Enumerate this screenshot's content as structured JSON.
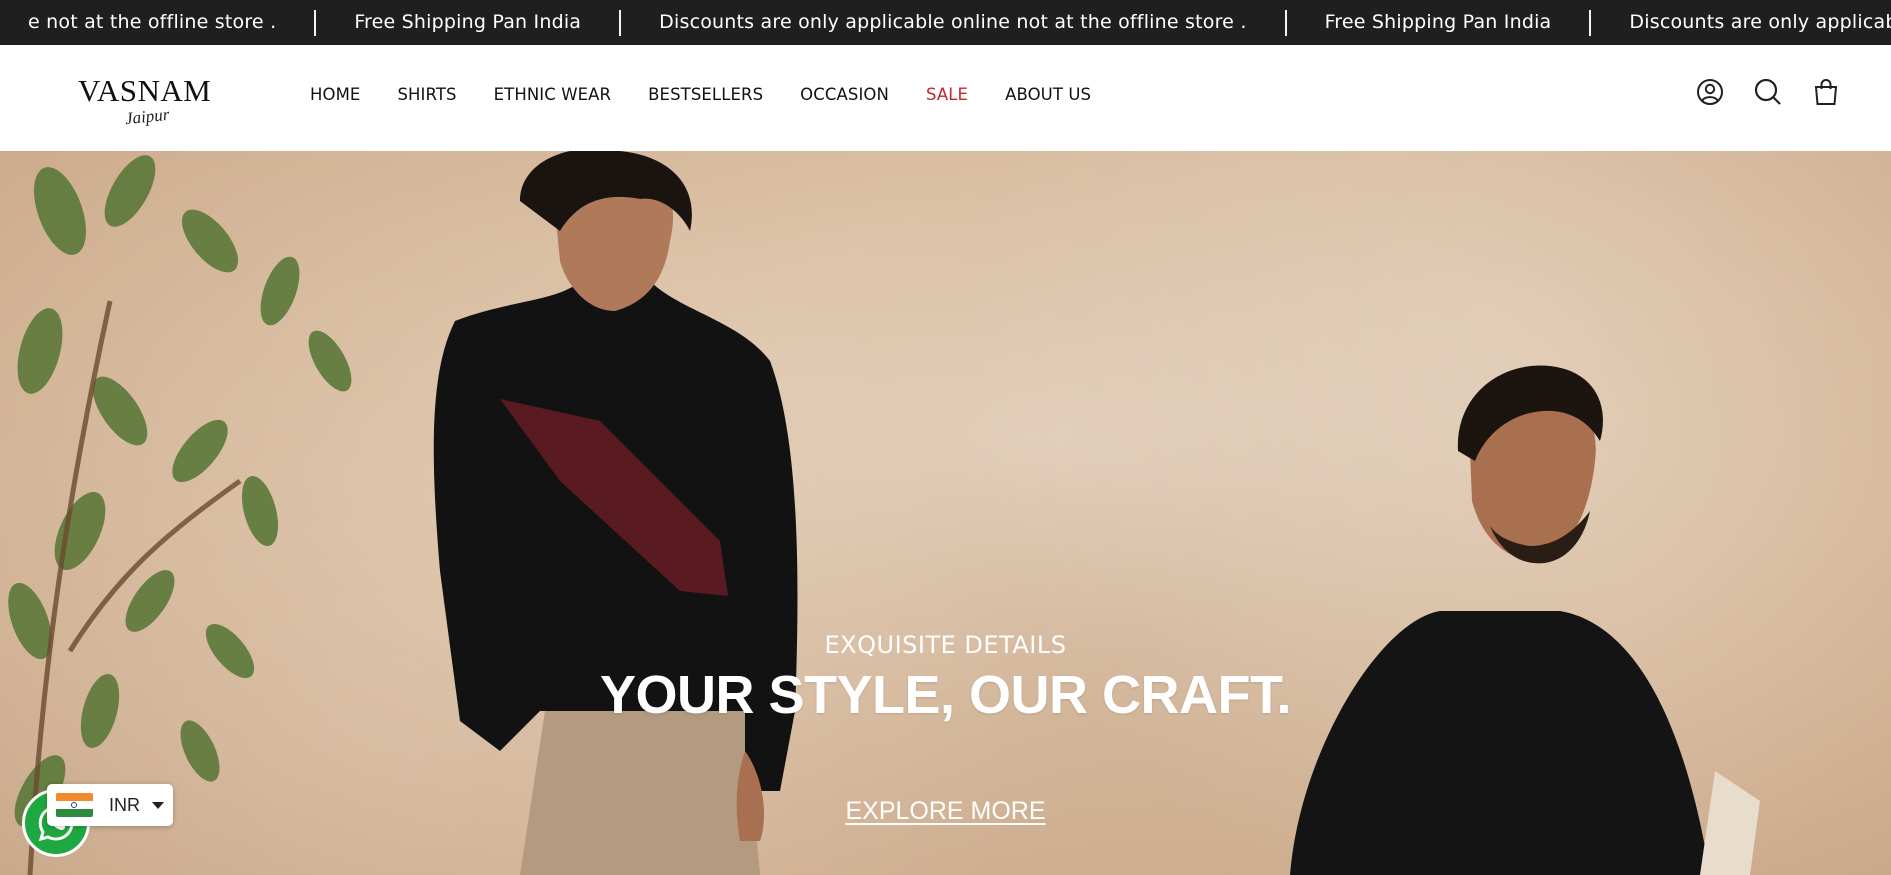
{
  "announcement": {
    "messages": [
      "e not at the offline store .",
      "Free Shipping Pan India",
      "Discounts are only applicable online not at the offline store .",
      "Free Shipping Pan India",
      "Discounts are only applicable online not at"
    ]
  },
  "header": {
    "logo_main": "VASNAM",
    "logo_sub": "Jaipur",
    "nav": [
      {
        "label": "HOME"
      },
      {
        "label": "SHIRTS"
      },
      {
        "label": "ETHNIC WEAR"
      },
      {
        "label": "BESTSELLERS"
      },
      {
        "label": "OCCASION"
      },
      {
        "label": "SALE"
      },
      {
        "label": "ABOUT US"
      }
    ],
    "icons": [
      "account-icon",
      "search-icon",
      "cart-icon"
    ]
  },
  "hero": {
    "eyebrow": "EXQUISITE DETAILS",
    "headline": "YOUR STYLE, OUR CRAFT.",
    "cta": "EXPLORE MORE"
  },
  "currency": {
    "code": "INR",
    "flag": "india-flag-icon"
  },
  "colors": {
    "announcement_bg": "#1f1f1f",
    "sale": "#c0262d",
    "whatsapp": "#1fa83f"
  }
}
